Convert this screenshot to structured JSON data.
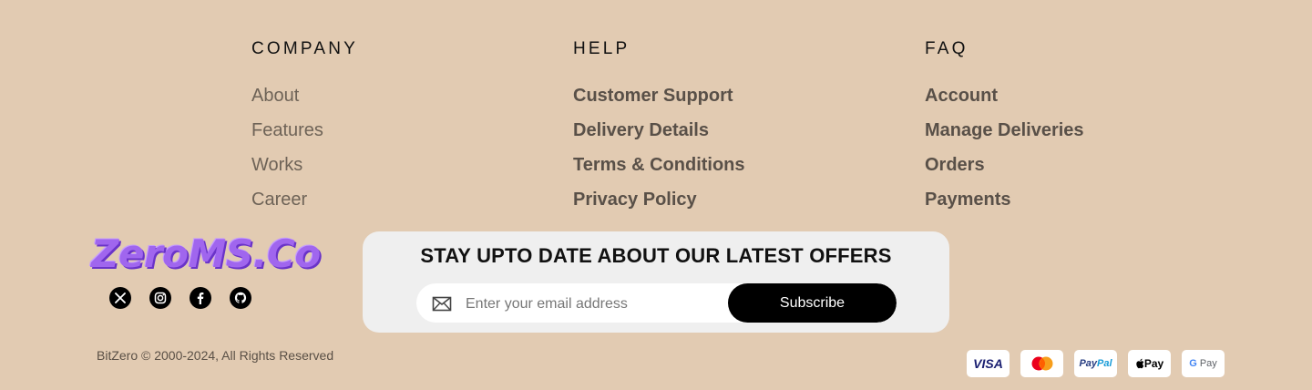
{
  "columns": [
    {
      "heading": "COMPANY",
      "links": [
        "About",
        "Features",
        "Works",
        "Career"
      ]
    },
    {
      "heading": "HELP",
      "links": [
        "Customer Support",
        "Delivery Details",
        "Terms & Conditions",
        "Privacy Policy"
      ]
    },
    {
      "heading": "FAQ",
      "links": [
        "Account",
        "Manage Deliveries",
        "Orders",
        "Payments"
      ]
    }
  ],
  "brand": {
    "logo_text": "ZeroMS.Co"
  },
  "socials": [
    "x-icon",
    "instagram-icon",
    "facebook-icon",
    "github-icon"
  ],
  "newsletter": {
    "heading": "STAY UPTO DATE ABOUT OUR LATEST OFFERS",
    "email_placeholder": "Enter your email address",
    "subscribe_label": "Subscribe"
  },
  "footer": {
    "copyright": "BitZero © 2000-2024, All Rights Reserved"
  },
  "payments": {
    "visa": "VISA",
    "paypal_a": "Pay",
    "paypal_b": "Pal",
    "applepay": "Pay",
    "gpay_g": "G",
    "gpay": "Pay"
  },
  "colors": {
    "background": "#e2cbb2",
    "logo": "#a066ee",
    "button": "#000000"
  }
}
